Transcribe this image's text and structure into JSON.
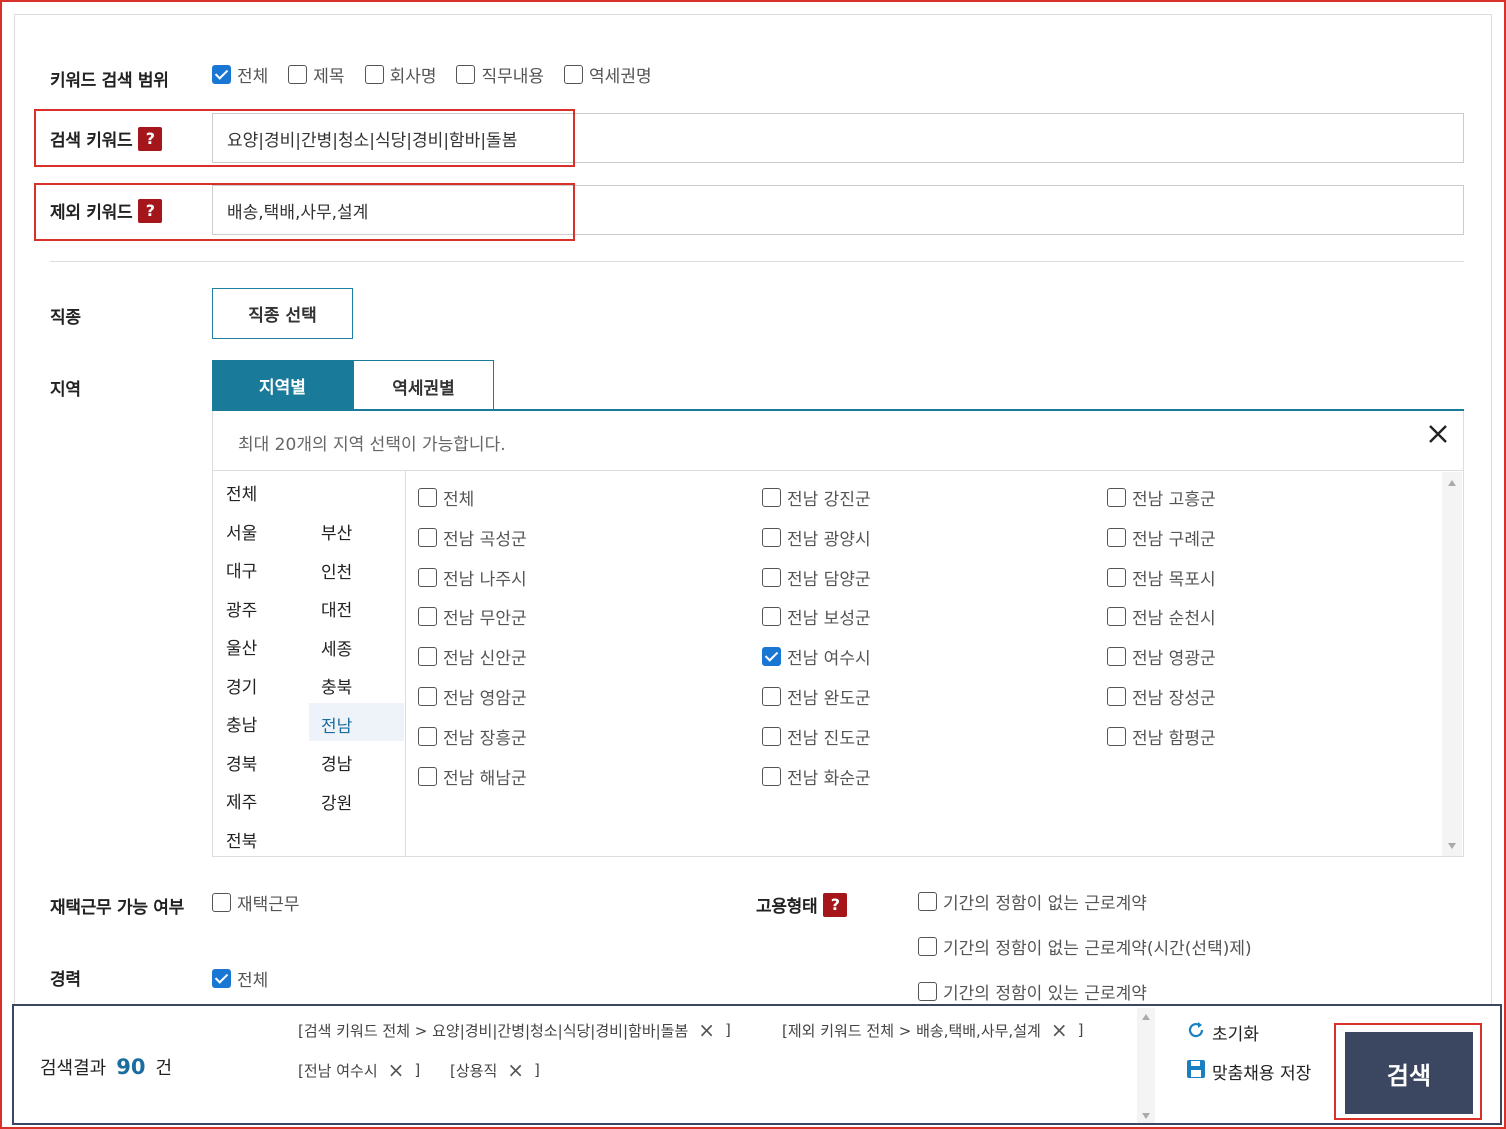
{
  "keyword_scope": {
    "label": "키워드 검색 범위",
    "options": [
      {
        "label": "전체",
        "checked": true
      },
      {
        "label": "제목",
        "checked": false
      },
      {
        "label": "회사명",
        "checked": false
      },
      {
        "label": "직무내용",
        "checked": false
      },
      {
        "label": "역세권명",
        "checked": false
      }
    ]
  },
  "search_keyword": {
    "label": "검색 키워드",
    "help": "?",
    "value": "요양|경비|간병|청소|식당|경비|함바|돌봄"
  },
  "exclude_keyword": {
    "label": "제외 키워드",
    "help": "?",
    "value": "배송,택배,사무,설계"
  },
  "job_type": {
    "label": "직종",
    "button": "직종 선택"
  },
  "region": {
    "label": "지역",
    "tabs": [
      {
        "label": "지역별",
        "active": true
      },
      {
        "label": "역세권별",
        "active": false
      }
    ],
    "notice": "최대 20개의 지역 선택이 가능합니다.",
    "close_icon": "close-icon",
    "provinces_col1": [
      "전체",
      "서울",
      "대구",
      "광주",
      "울산",
      "경기",
      "충남",
      "경북",
      "제주",
      "전북"
    ],
    "provinces_col2": [
      "부산",
      "인천",
      "대전",
      "세종",
      "충북",
      "전남",
      "경남",
      "강원"
    ],
    "selected_province": "전남",
    "districts": [
      {
        "label": "전체",
        "checked": false
      },
      {
        "label": "전남 강진군",
        "checked": false
      },
      {
        "label": "전남 고흥군",
        "checked": false
      },
      {
        "label": "전남 곡성군",
        "checked": false
      },
      {
        "label": "전남 광양시",
        "checked": false
      },
      {
        "label": "전남 구례군",
        "checked": false
      },
      {
        "label": "전남 나주시",
        "checked": false
      },
      {
        "label": "전남 담양군",
        "checked": false
      },
      {
        "label": "전남 목포시",
        "checked": false
      },
      {
        "label": "전남 무안군",
        "checked": false
      },
      {
        "label": "전남 보성군",
        "checked": false
      },
      {
        "label": "전남 순천시",
        "checked": false
      },
      {
        "label": "전남 신안군",
        "checked": false
      },
      {
        "label": "전남 여수시",
        "checked": true
      },
      {
        "label": "전남 영광군",
        "checked": false
      },
      {
        "label": "전남 영암군",
        "checked": false
      },
      {
        "label": "전남 완도군",
        "checked": false
      },
      {
        "label": "전남 장성군",
        "checked": false
      },
      {
        "label": "전남 장흥군",
        "checked": false
      },
      {
        "label": "전남 진도군",
        "checked": false
      },
      {
        "label": "전남 함평군",
        "checked": false
      },
      {
        "label": "전남 해남군",
        "checked": false
      },
      {
        "label": "전남 화순군",
        "checked": false
      }
    ]
  },
  "remote": {
    "label": "재택근무 가능 여부",
    "option": "재택근무",
    "checked": false
  },
  "employment": {
    "label": "고용형태",
    "help": "?",
    "options": [
      {
        "label": "기간의 정함이 없는 근로계약",
        "checked": false
      },
      {
        "label": "기간의 정함이 없는 근로계약(시간(선택)제)",
        "checked": false
      },
      {
        "label": "기간의 정함이 있는 근로계약",
        "checked": false
      }
    ]
  },
  "career": {
    "label": "경력",
    "option": "전체",
    "checked": true
  },
  "result_bar": {
    "prefix": "검색결과",
    "count": "90",
    "suffix": "건",
    "tags": [
      "[검색 키워드 전체 > 요양|경비|간병|청소|식당|경비|함바|돌봄",
      "[제외 키워드 전체 > 배송,택배,사무,설계",
      "[전남 여수시",
      "[상용직"
    ],
    "tag_close": "×",
    "tag_end": "]",
    "reset_label": "초기화",
    "save_label": "맞춤채용 저장",
    "search_label": "검색"
  },
  "colors": {
    "accent": "#1a7a9a",
    "search_button": "#3b4660",
    "highlight_box": "#d9302a",
    "help_badge": "#a4161a",
    "checkbox": "#1976d2"
  }
}
